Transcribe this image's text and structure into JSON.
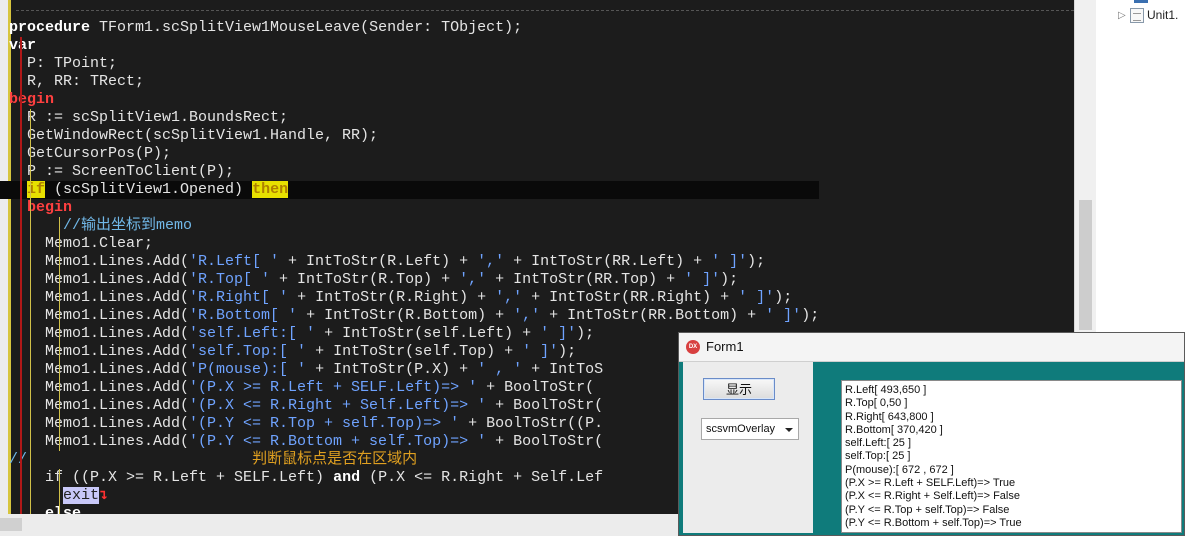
{
  "editor": {
    "lines": [
      "procedure TForm1.scSplitView1MouseLeave(Sender: TObject);",
      "var",
      "  P: TPoint;",
      "  R, RR: TRect;",
      "begin",
      "  R := scSplitView1.BoundsRect;",
      "  GetWindowRect(scSplitView1.Handle, RR);",
      "  GetCursorPos(P);",
      "  P := ScreenToClient(P);",
      "  if (scSplitView1.Opened) then",
      "  begin",
      "      //输出坐标到memo",
      "    Memo1.Clear;",
      "    Memo1.Lines.Add('R.Left[ ' + IntToStr(R.Left) + ',' + IntToStr(RR.Left) + ' ]');",
      "    Memo1.Lines.Add('R.Top[ ' + IntToStr(R.Top) + ',' + IntToStr(RR.Top) + ' ]');",
      "    Memo1.Lines.Add('R.Right[ ' + IntToStr(R.Right) + ',' + IntToStr(RR.Right) + ' ]');",
      "    Memo1.Lines.Add('R.Bottom[ ' + IntToStr(R.Bottom) + ',' + IntToStr(RR.Bottom) + ' ]');",
      "    Memo1.Lines.Add('self.Left:[ ' + IntToStr(self.Left) + ' ]');",
      "    Memo1.Lines.Add('self.Top:[ ' + IntToStr(self.Top) + ' ]');",
      "    Memo1.Lines.Add('P(mouse):[ ' + IntToStr(P.X) + ' , ' + IntToS",
      "    Memo1.Lines.Add('(P.X >= R.Left + SELF.Left)=> ' + BoolToStr(",
      "    Memo1.Lines.Add('(P.X <= R.Right + Self.Left)=> ' + BoolToStr(",
      "    Memo1.Lines.Add('(P.Y <= R.Top + self.Top)=> ' + BoolToStr((P.",
      "    Memo1.Lines.Add('(P.Y <= R.Bottom + self.Top)=> ' + BoolToStr(",
      "//                         判断鼠标点是否在区域内",
      "    if ((P.X >= R.Left + SELF.Left) and (P.X <= R.Right + Self.Lef",
      "      exit",
      "    else"
    ]
  },
  "side_pane": {
    "tree_item": "Unit1."
  },
  "form": {
    "title": "Form1",
    "icon_text": "DX",
    "show_button": "显示",
    "combo_value": "scsvmOverlay",
    "memo_lines": [
      "R.Left[ 493,650 ]",
      "R.Top[ 0,50 ]",
      "R.Right[ 643,800 ]",
      "R.Bottom[ 370,420 ]",
      "self.Left:[ 25 ]",
      "self.Top:[ 25 ]",
      "P(mouse):[ 672 , 672 ]",
      "(P.X >= R.Left + SELF.Left)=> True",
      "(P.X <= R.Right + Self.Left)=> False",
      "(P.Y <= R.Top + self.Top)=> False",
      "(P.Y <= R.Bottom + self.Top)=> True"
    ]
  }
}
